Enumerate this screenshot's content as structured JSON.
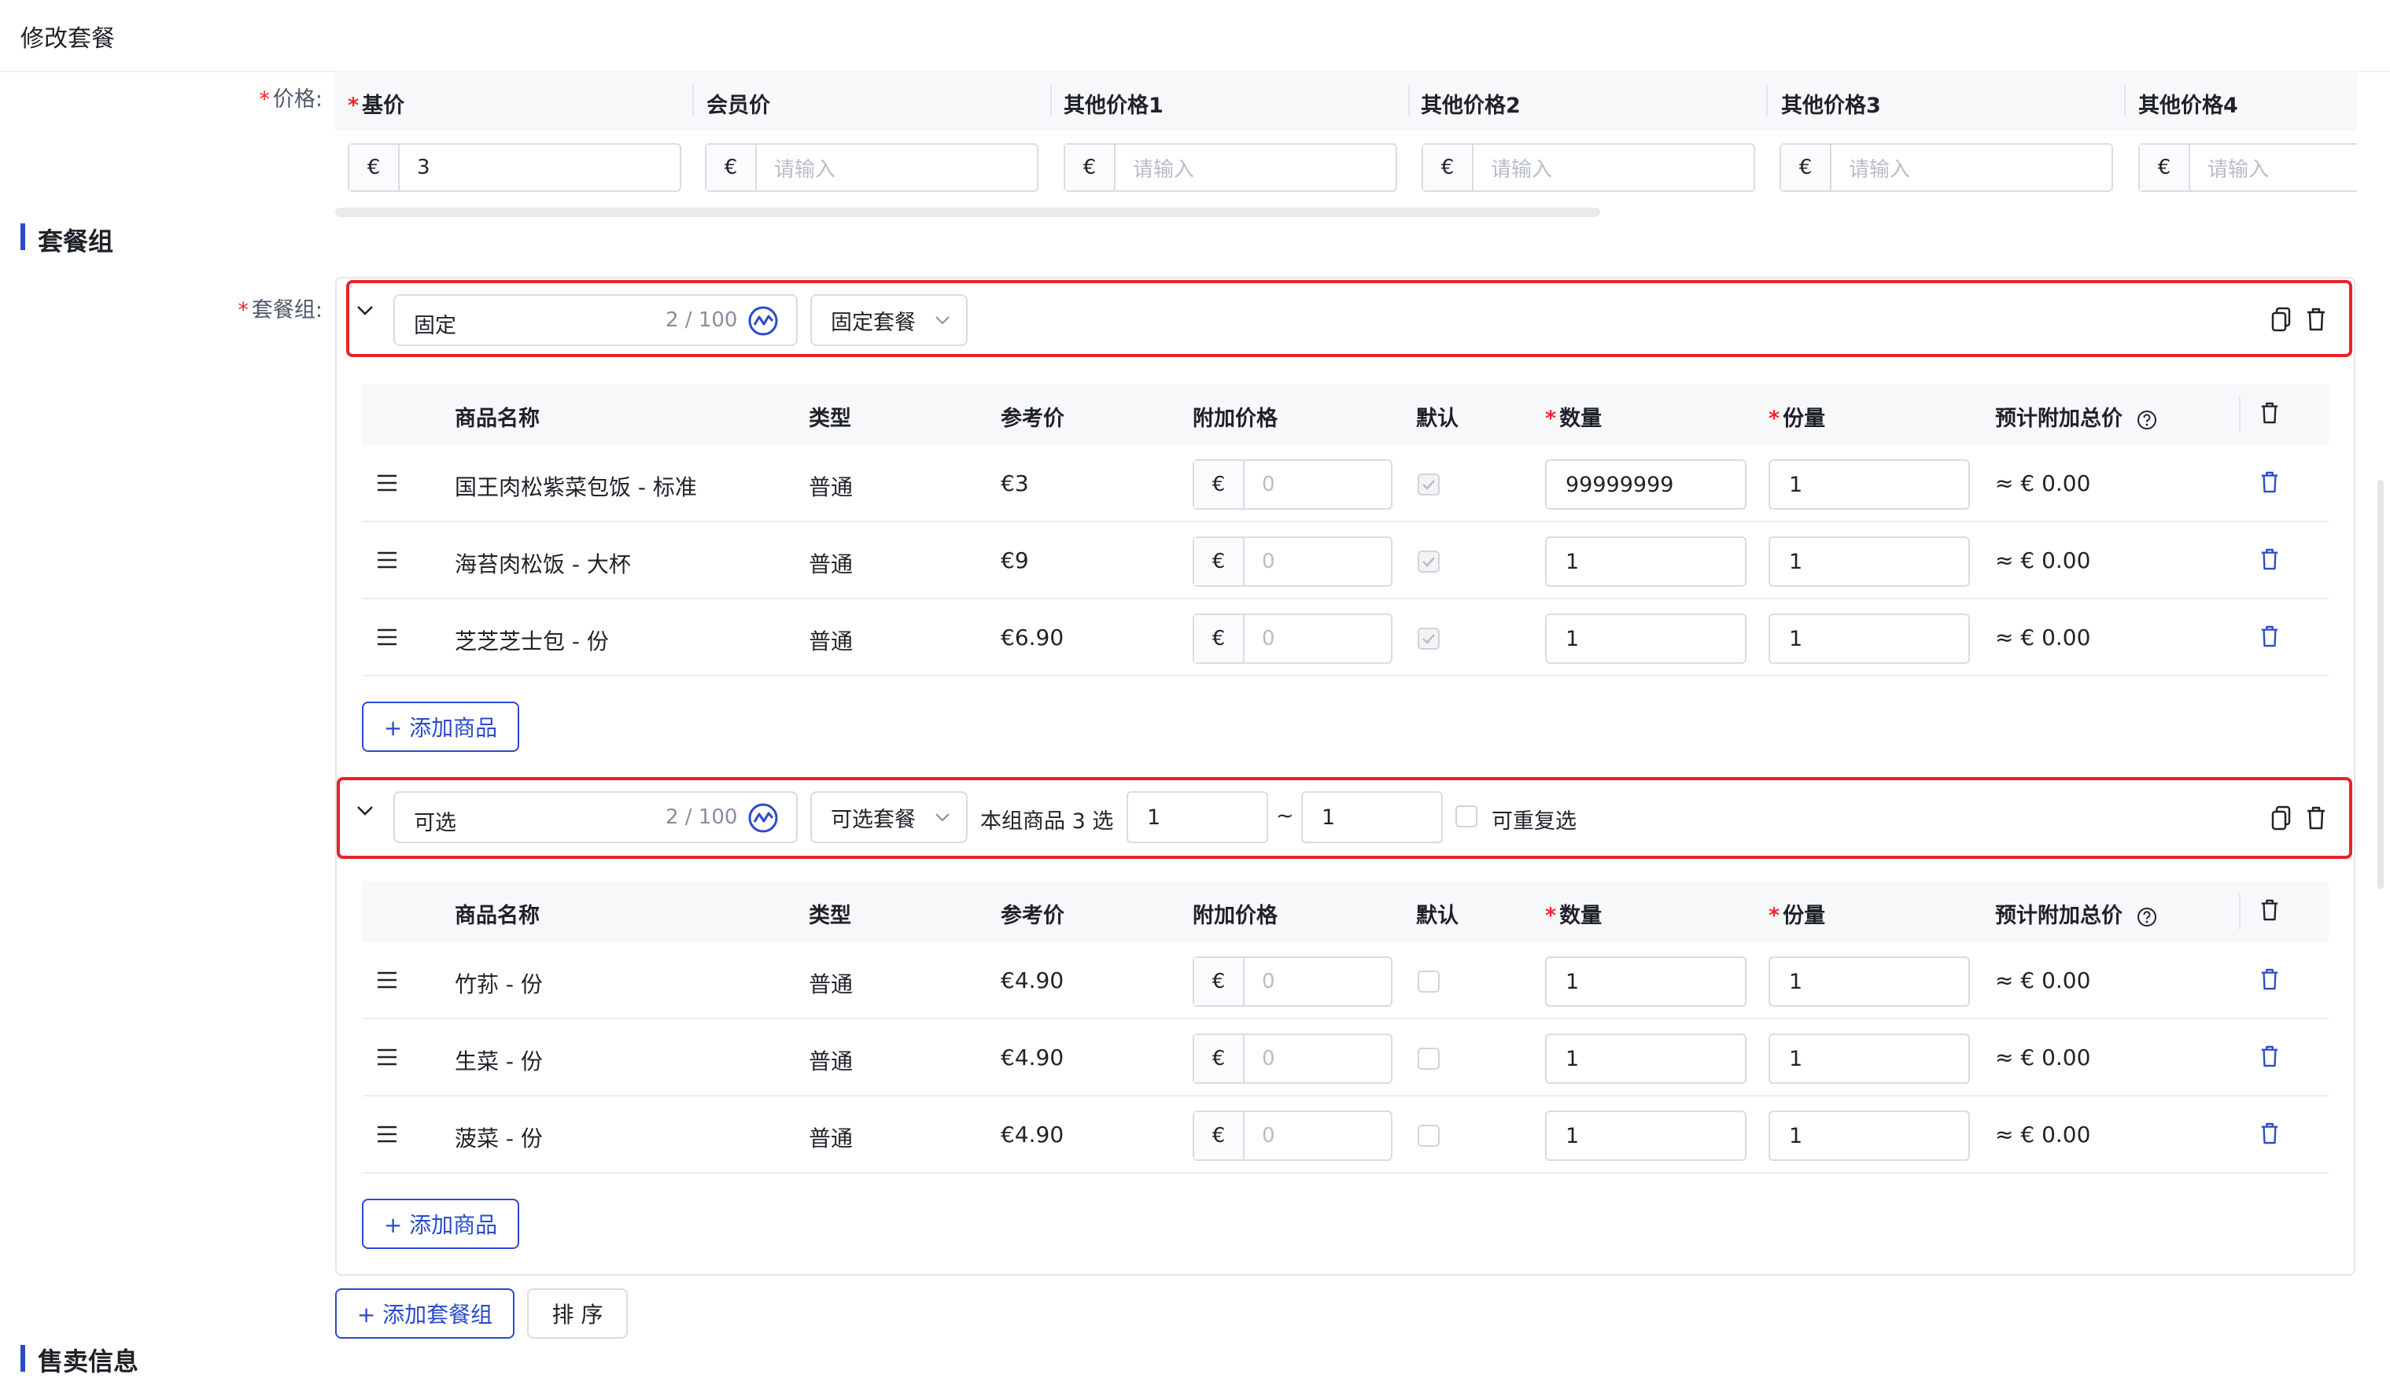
{
  "page": {
    "title": "修改套餐"
  },
  "price": {
    "label": "价格",
    "columns": [
      {
        "label": "基价",
        "required": true,
        "currency": "€",
        "value": "3",
        "placeholder": ""
      },
      {
        "label": "会员价",
        "required": false,
        "currency": "€",
        "value": "",
        "placeholder": "请输入"
      },
      {
        "label": "其他价格1",
        "required": false,
        "currency": "€",
        "value": "",
        "placeholder": "请输入"
      },
      {
        "label": "其他价格2",
        "required": false,
        "currency": "€",
        "value": "",
        "placeholder": "请输入"
      },
      {
        "label": "其他价格3",
        "required": false,
        "currency": "€",
        "value": "",
        "placeholder": "请输入"
      },
      {
        "label": "其他价格4",
        "required": false,
        "currency": "€",
        "value": "",
        "placeholder": "请输入"
      }
    ]
  },
  "section_combo": {
    "title": "套餐组",
    "label": "套餐组"
  },
  "table_headers": {
    "name": "商品名称",
    "type": "类型",
    "ref_price": "参考价",
    "addon_price": "附加价格",
    "default": "默认",
    "qty": "数量",
    "portion": "份量",
    "est_total": "预计附加总价"
  },
  "groups": [
    {
      "name": "固定",
      "counter": "2 / 100",
      "select": "固定套餐",
      "rows": [
        {
          "name": "国王肉松紫菜包饭 - 标准",
          "type": "普通",
          "ref": "€3",
          "cur": "€",
          "addon": "0",
          "qty": "99999999",
          "portion": "1",
          "total": "≈ € 0.00",
          "checked": true
        },
        {
          "name": "海苔肉松饭 - 大杯",
          "type": "普通",
          "ref": "€9",
          "cur": "€",
          "addon": "0",
          "qty": "1",
          "portion": "1",
          "total": "≈ € 0.00",
          "checked": true
        },
        {
          "name": "芝芝芝士包 - 份",
          "type": "普通",
          "ref": "€6.90",
          "cur": "€",
          "addon": "0",
          "qty": "1",
          "portion": "1",
          "total": "≈ € 0.00",
          "checked": true
        }
      ],
      "add_label": "+ 添加商品"
    },
    {
      "name": "可选",
      "counter": "2 / 100",
      "select": "可选套餐",
      "choose_text": "本组商品 3 选",
      "min": "1",
      "tilde": "~",
      "max": "1",
      "repeat_label": "可重复选",
      "rows": [
        {
          "name": "竹荪 - 份",
          "type": "普通",
          "ref": "€4.90",
          "cur": "€",
          "addon": "0",
          "qty": "1",
          "portion": "1",
          "total": "≈ € 0.00",
          "checked": false
        },
        {
          "name": "生菜 - 份",
          "type": "普通",
          "ref": "€4.90",
          "cur": "€",
          "addon": "0",
          "qty": "1",
          "portion": "1",
          "total": "≈ € 0.00",
          "checked": false
        },
        {
          "name": "菠菜 - 份",
          "type": "普通",
          "ref": "€4.90",
          "cur": "€",
          "addon": "0",
          "qty": "1",
          "portion": "1",
          "total": "≈ € 0.00",
          "checked": false
        }
      ],
      "add_label": "+ 添加商品"
    }
  ],
  "footer": {
    "add_group": "+ 添加套餐组",
    "sort": "排 序"
  },
  "section_sale": {
    "title": "售卖信息"
  },
  "colors": {
    "accent": "#2b4acb",
    "highlight_border": "#e8232a",
    "required": "#f5222d"
  }
}
